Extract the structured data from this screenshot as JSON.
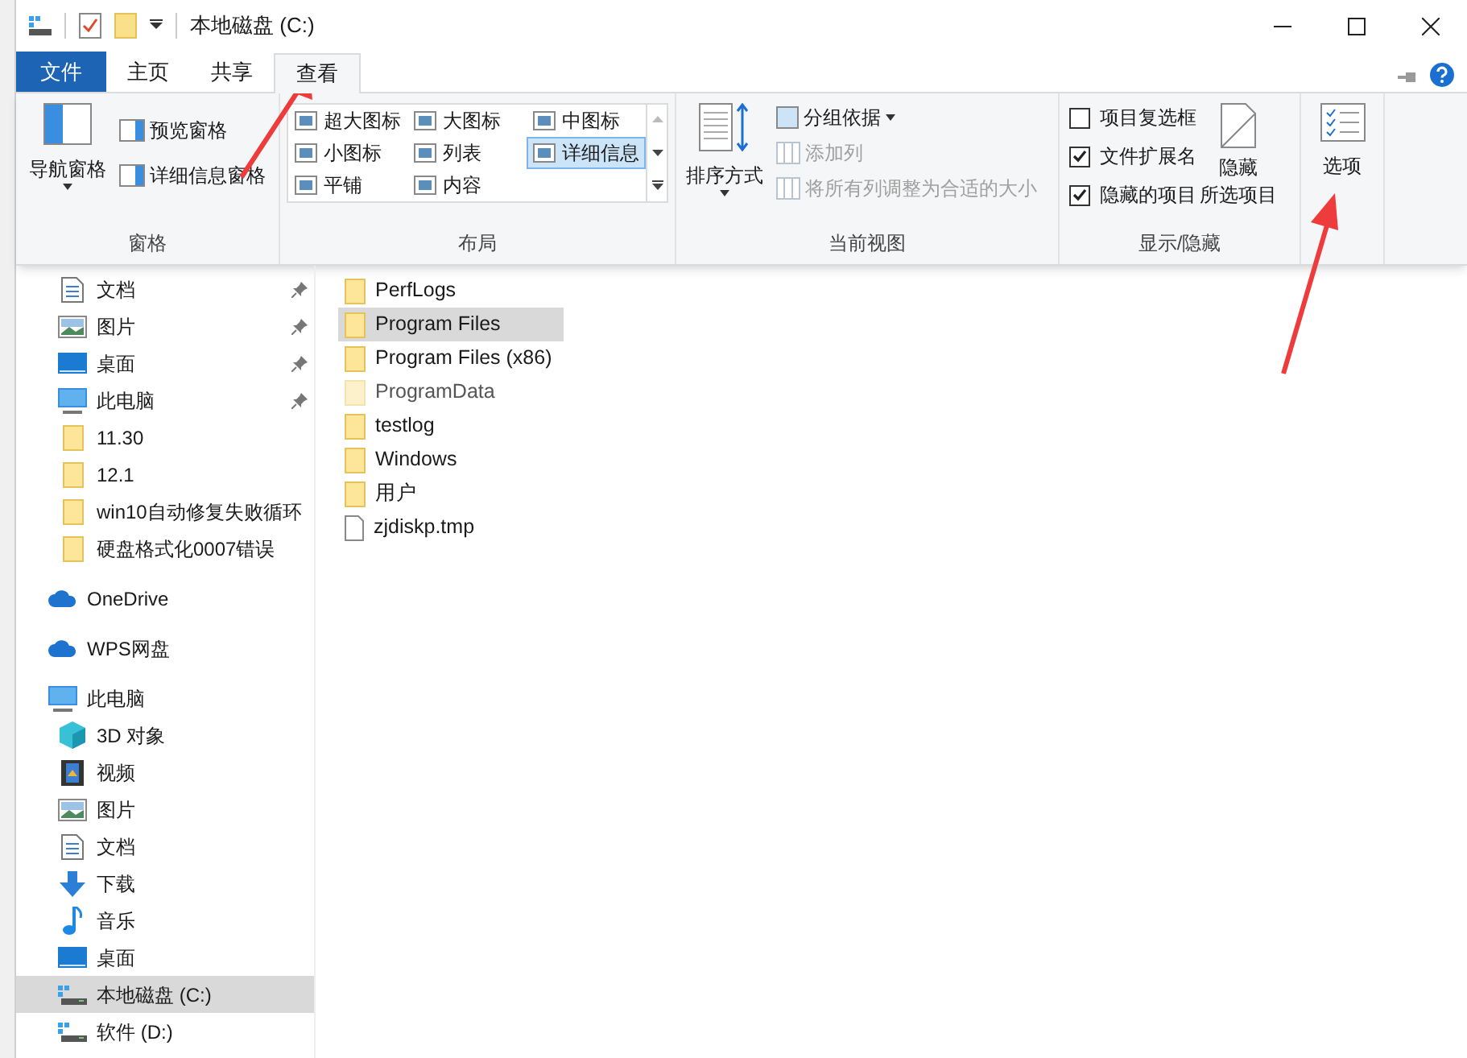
{
  "window": {
    "title": "本地磁盘 (C:)"
  },
  "tabs": [
    {
      "label": "文件",
      "kind": "file",
      "selected": false
    },
    {
      "label": "主页",
      "kind": "tab",
      "selected": false
    },
    {
      "label": "共享",
      "kind": "tab",
      "selected": false
    },
    {
      "label": "查看",
      "kind": "tab",
      "selected": true
    }
  ],
  "panes_group": {
    "label": "窗格",
    "navigation_pane": "导航窗格",
    "preview_pane": "预览窗格",
    "details_pane": "详细信息窗格"
  },
  "layout_group": {
    "label": "布局",
    "options": [
      {
        "label": "超大图标",
        "selected": false
      },
      {
        "label": "大图标",
        "selected": false
      },
      {
        "label": "中图标",
        "selected": false
      },
      {
        "label": "小图标",
        "selected": false
      },
      {
        "label": "列表",
        "selected": false
      },
      {
        "label": "详细信息",
        "selected": true
      },
      {
        "label": "平铺",
        "selected": false
      },
      {
        "label": "内容",
        "selected": false
      }
    ]
  },
  "current_view_group": {
    "label": "当前视图",
    "sort_by": "排序方式",
    "group_by": "分组依据",
    "add_columns": {
      "label": "添加列",
      "disabled": true
    },
    "size_columns": {
      "label": "将所有列调整为合适的大小",
      "disabled": true
    }
  },
  "show_hide_group": {
    "label": "显示/隐藏",
    "checkboxes": [
      {
        "label": "项目复选框",
        "checked": false
      },
      {
        "label": "文件扩展名",
        "checked": true
      },
      {
        "label": "隐藏的项目",
        "checked": true
      }
    ],
    "hide_selected": [
      "隐藏",
      "所选项目"
    ]
  },
  "options_button": {
    "label": "选项"
  },
  "navigation": {
    "sections": [
      {
        "items": [
          {
            "label": "文档",
            "kind": "document",
            "pinned": true,
            "selected": false
          },
          {
            "label": "图片",
            "kind": "picture",
            "pinned": true,
            "selected": false
          },
          {
            "label": "桌面",
            "kind": "desktop",
            "pinned": true,
            "selected": false
          },
          {
            "label": "此电脑",
            "kind": "pc",
            "pinned": true,
            "selected": false
          },
          {
            "label": "11.30",
            "kind": "folder",
            "pinned": false,
            "selected": false
          },
          {
            "label": "12.1",
            "kind": "folder",
            "pinned": false,
            "selected": false
          },
          {
            "label": "win10自动修复失败循环",
            "kind": "folder",
            "pinned": false,
            "selected": false
          },
          {
            "label": "硬盘格式化0007错误",
            "kind": "folder",
            "pinned": false,
            "selected": false
          }
        ]
      },
      {
        "label": "OneDrive",
        "kind": "cloud"
      },
      {
        "label": "WPS网盘",
        "kind": "cloud"
      },
      {
        "label": "此电脑",
        "kind": "pc",
        "children": [
          {
            "label": "3D 对象",
            "kind": "cube",
            "pinned": false,
            "selected": false
          },
          {
            "label": "视频",
            "kind": "video",
            "pinned": false,
            "selected": false
          },
          {
            "label": "图片",
            "kind": "picture",
            "pinned": false,
            "selected": false
          },
          {
            "label": "文档",
            "kind": "document",
            "pinned": false,
            "selected": false
          },
          {
            "label": "下载",
            "kind": "download",
            "pinned": false,
            "selected": false
          },
          {
            "label": "音乐",
            "kind": "music",
            "pinned": false,
            "selected": false
          },
          {
            "label": "桌面",
            "kind": "desktop",
            "pinned": false,
            "selected": false
          },
          {
            "label": "本地磁盘 (C:)",
            "kind": "drive",
            "pinned": false,
            "selected": true
          },
          {
            "label": "软件 (D:)",
            "kind": "drive",
            "pinned": false,
            "selected": false
          }
        ]
      }
    ]
  },
  "files": [
    {
      "name": "PerfLogs",
      "kind": "folder",
      "hidden": false,
      "selected": false
    },
    {
      "name": "Program Files",
      "kind": "folder",
      "hidden": false,
      "selected": true
    },
    {
      "name": "Program Files (x86)",
      "kind": "folder",
      "hidden": false,
      "selected": false
    },
    {
      "name": "ProgramData",
      "kind": "folder",
      "hidden": true,
      "selected": false
    },
    {
      "name": "testlog",
      "kind": "folder",
      "hidden": false,
      "selected": false
    },
    {
      "name": "Windows",
      "kind": "folder",
      "hidden": false,
      "selected": false
    },
    {
      "name": "用户",
      "kind": "folder",
      "hidden": false,
      "selected": false
    },
    {
      "name": "zjdiskp.tmp",
      "kind": "file",
      "hidden": false,
      "selected": false
    }
  ]
}
